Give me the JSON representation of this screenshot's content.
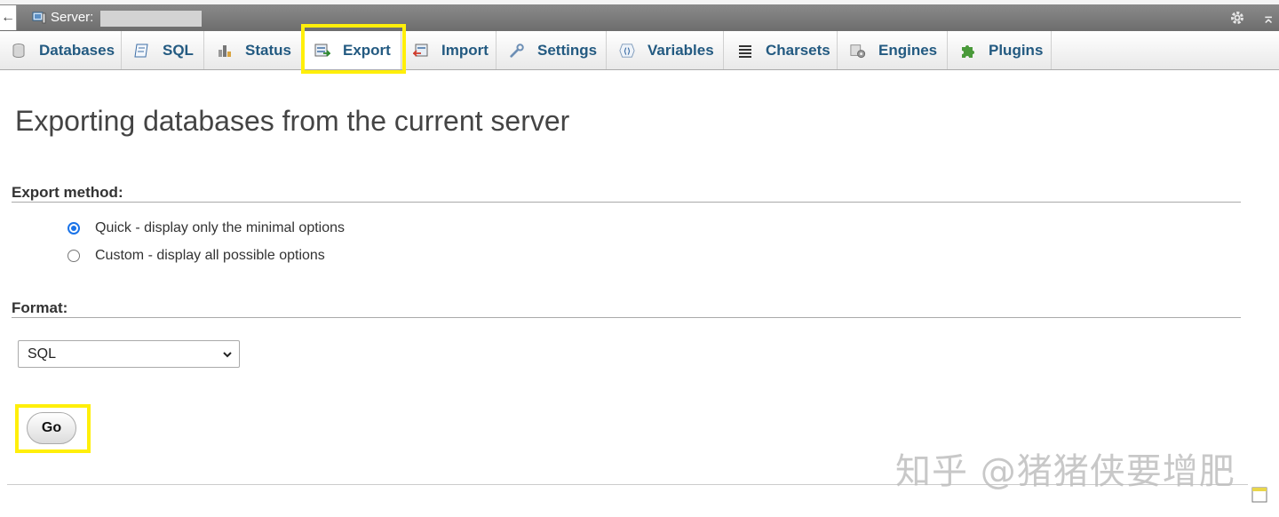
{
  "server_bar": {
    "back_arrow": "←",
    "label": "Server:",
    "icons": [
      "server-icon",
      "gear-icon",
      "collapse-icon"
    ]
  },
  "tabs": [
    {
      "label": "Databases",
      "icon": "database-icon",
      "active": false
    },
    {
      "label": "SQL",
      "icon": "sql-icon",
      "active": false
    },
    {
      "label": "Status",
      "icon": "status-icon",
      "active": false
    },
    {
      "label": "Export",
      "icon": "export-icon",
      "active": true
    },
    {
      "label": "Import",
      "icon": "import-icon",
      "active": false
    },
    {
      "label": "Settings",
      "icon": "wrench-icon",
      "active": false
    },
    {
      "label": "Variables",
      "icon": "variables-icon",
      "active": false
    },
    {
      "label": "Charsets",
      "icon": "charsets-icon",
      "active": false
    },
    {
      "label": "Engines",
      "icon": "engines-icon",
      "active": false
    },
    {
      "label": "Plugins",
      "icon": "puzzle-icon",
      "active": false
    }
  ],
  "main": {
    "title": "Exporting databases from the current server",
    "export_method": {
      "label": "Export method:",
      "options": [
        {
          "label": "Quick - display only the minimal options",
          "selected": true
        },
        {
          "label": "Custom - display all possible options",
          "selected": false
        }
      ]
    },
    "format": {
      "label": "Format:",
      "selected": "SQL"
    },
    "go_label": "Go"
  },
  "watermark": "知乎 @猪猪侠要增肥",
  "colors": {
    "tab_text": "#235a81",
    "highlight": "#ffef0a",
    "server_bar": "#7a7a7a",
    "radio_selected": "#1a73e8"
  }
}
